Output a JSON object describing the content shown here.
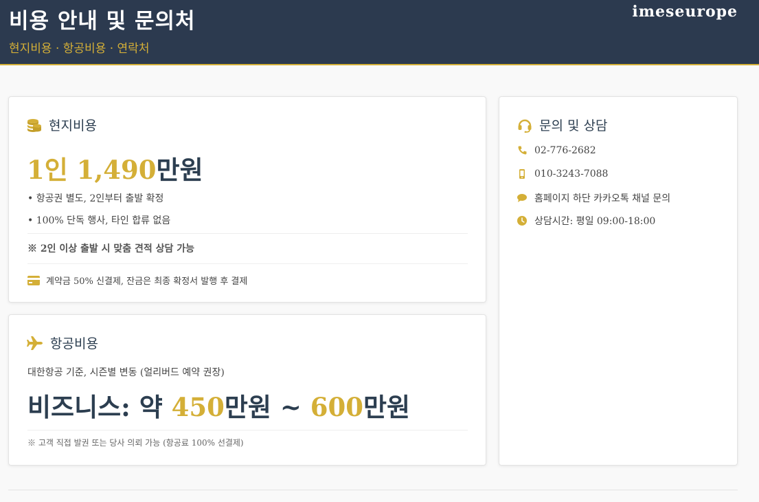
{
  "header": {
    "title": "비용 안내 및 문의처",
    "subtitle": "현지비용 · 항공비용 · 연락처",
    "brand": "imeseurope"
  },
  "local_cost": {
    "icon": "coins-icon",
    "title": "현지비용",
    "price_prefix": "1인 1,490",
    "price_suffix": "만원",
    "bullets": [
      "• 항공권 별도, 2인부터 출발 확정",
      "• 100% 단독 행사, 타인 합류 없음"
    ],
    "note": "※ 2인 이상 출발 시 맞춤 견적 상담 가능",
    "payment_icon": "credit-card-icon",
    "payment": "계약금 50% 신결제, 잔금은 최종 확정서 발행 후 결제"
  },
  "air_cost": {
    "icon": "plane-icon",
    "title": "항공비용",
    "description": "대한항공 기준, 시즌별 변동 (얼리버드 예약 권장)",
    "price_label": "비즈니스: 약 ",
    "price_min": "450",
    "price_unit_1": "만원 ~ ",
    "price_max": "600",
    "price_unit_2": "만원",
    "note": "※ 고객 직접 발권 또는 당사 의뢰 가능 (항공료 100% 선결제)"
  },
  "contact": {
    "icon": "headset-icon",
    "title": "문의 및 상담",
    "items": [
      {
        "icon": "phone-icon",
        "text": "02-776-2682"
      },
      {
        "icon": "mobile-icon",
        "text": "010-3243-7088"
      },
      {
        "icon": "chat-icon",
        "text": "홈페이지 하단 카카오톡 채널 문의"
      },
      {
        "icon": "clock-icon",
        "text": "상담시간: 평일 09:00-18:00"
      }
    ]
  },
  "colors": {
    "header_bg": "#2c3a4f",
    "accent_gold": "#d4af37",
    "text_dark": "#2c3e50",
    "page_bg": "#f9f9f9"
  }
}
